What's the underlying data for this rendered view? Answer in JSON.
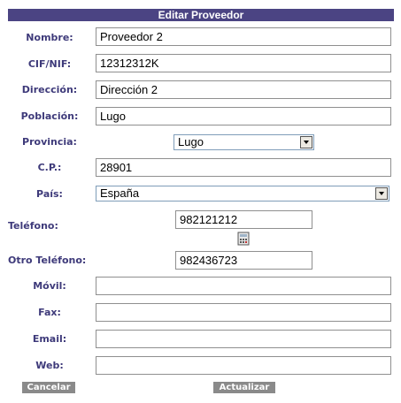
{
  "header": {
    "title": "Editar Proveedor"
  },
  "fields": {
    "nombre": {
      "label": "Nombre:",
      "value": "Proveedor 2"
    },
    "cif": {
      "label": "CIF/NIF:",
      "value": "12312312K"
    },
    "direccion": {
      "label": "Dirección:",
      "value": "Dirección 2"
    },
    "poblacion": {
      "label": "Población:",
      "value": "Lugo"
    },
    "provincia": {
      "label": "Provincia:",
      "value": "Lugo"
    },
    "cp": {
      "label": "C.P.:",
      "value": "28901"
    },
    "pais": {
      "label": "País:",
      "value": "España"
    },
    "telefono": {
      "label": "Teléfono:",
      "value": "982121212"
    },
    "otro_telefono": {
      "label": "Otro Teléfono:",
      "value": "982436723"
    },
    "movil": {
      "label": "Móvil:",
      "value": ""
    },
    "fax": {
      "label": "Fax:",
      "value": ""
    },
    "email": {
      "label": "Email:",
      "value": ""
    },
    "web": {
      "label": "Web:",
      "value": ""
    }
  },
  "icons": {
    "telefono_picker": "calculator-icon"
  },
  "buttons": {
    "cancelar": "Cancelar",
    "actualizar": "Actualizar"
  },
  "colors": {
    "header_bg": "#4b4483",
    "label": "#3e3a7a",
    "button_bg": "#8a8a8a"
  }
}
